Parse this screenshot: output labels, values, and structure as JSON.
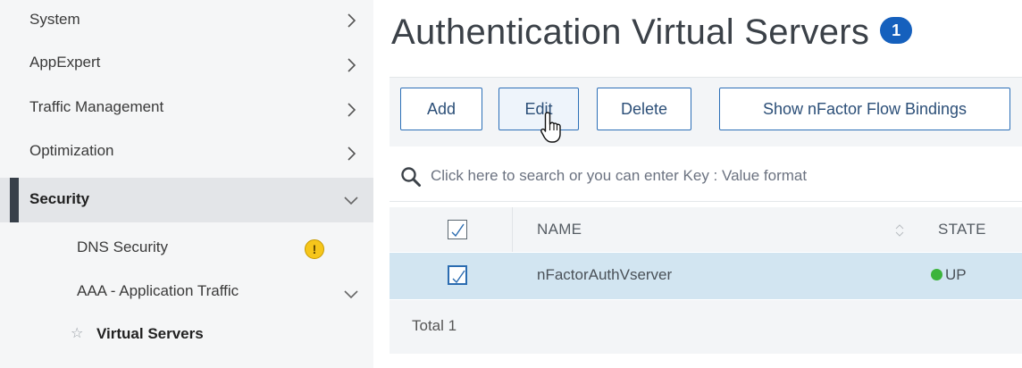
{
  "sidebar": {
    "items": [
      {
        "label": "System"
      },
      {
        "label": "AppExpert"
      },
      {
        "label": "Traffic Management"
      },
      {
        "label": "Optimization"
      },
      {
        "label": "Security"
      }
    ],
    "sub_items": [
      {
        "label": "DNS Security",
        "badge": "!"
      },
      {
        "label": "AAA - Application Traffic"
      },
      {
        "label": "Virtual Servers"
      }
    ]
  },
  "main": {
    "title": "Authentication Virtual Servers",
    "count": "1",
    "toolbar": {
      "add_label": "Add",
      "edit_label": "Edit",
      "delete_label": "Delete",
      "flow_label": "Show nFactor Flow Bindings"
    },
    "search": {
      "placeholder": "Click here to search or you can enter Key : Value format"
    },
    "table": {
      "columns": [
        "NAME",
        "STATE"
      ],
      "rows": [
        {
          "name": "nFactorAuthVserver",
          "state": "UP"
        }
      ],
      "footer_label": "Total",
      "footer_count": "1"
    }
  },
  "colors": {
    "accent": "#1560bd",
    "selected_row": "#d2e5f1",
    "status_up": "#3cb43c",
    "warning": "#f6c61b"
  },
  "icons": [
    "chevron-right-icon",
    "chevron-down-icon",
    "warning-icon",
    "star-icon",
    "search-icon",
    "checkbox-icon",
    "sort-icon",
    "pointer-cursor-icon",
    "status-dot-icon"
  ]
}
